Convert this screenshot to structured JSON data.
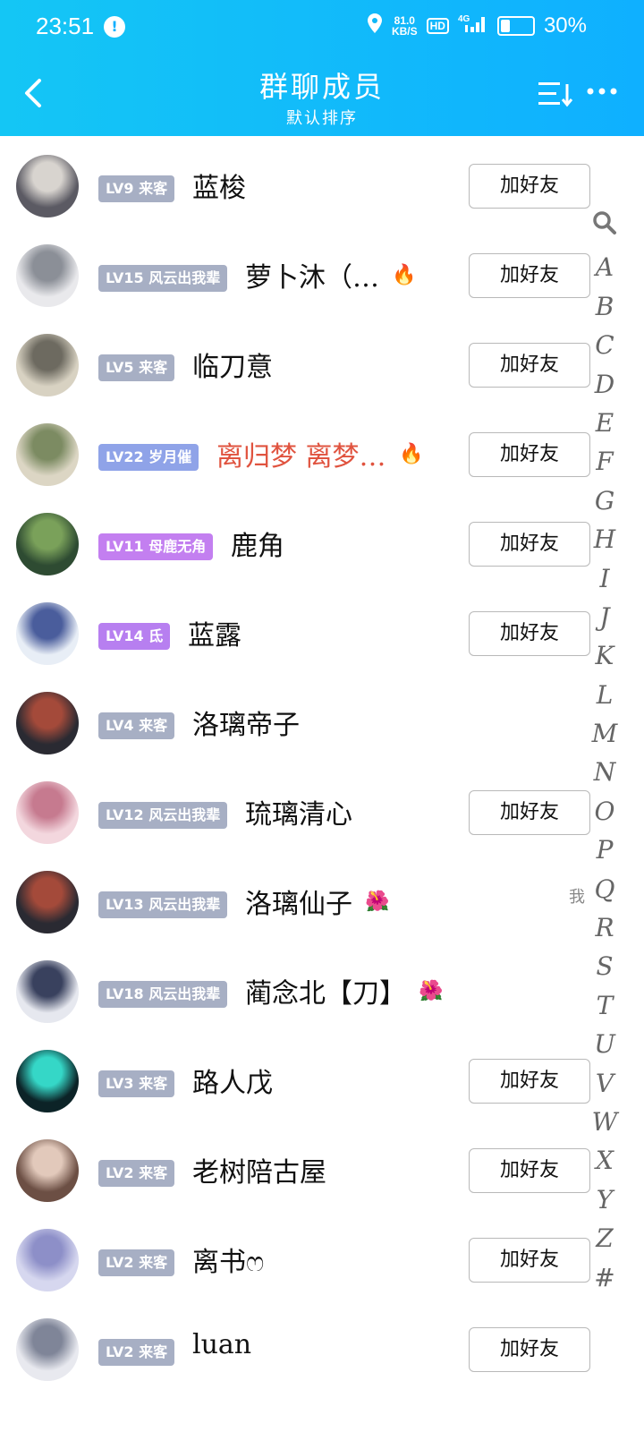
{
  "status_bar": {
    "time": "23:51",
    "notification": "!",
    "net_speed_value": "81.0",
    "net_speed_unit": "KB/S",
    "hd": "HD",
    "network": "4G",
    "battery_percent": "30%",
    "battery_level": 0.3
  },
  "nav": {
    "back_icon": "chevron-left-icon",
    "title": "群聊成员",
    "subtitle": "默认排序",
    "sort_icon": "sort-icon",
    "more_icon": "more-icon"
  },
  "members": [
    {
      "badge": "LV9 来客",
      "name": "蓝梭",
      "button": "加好友",
      "badge_color": "#a7afc4",
      "name_color": "#111111"
    },
    {
      "badge": "LV15 风云出我辈",
      "name": "萝卜沐（…",
      "button": "加好友",
      "emoji": "🔥",
      "badge_color": "#a7afc4",
      "name_color": "#111111"
    },
    {
      "badge": "LV5 来客",
      "name": "临刀意",
      "button": "加好友",
      "badge_color": "#a7afc4",
      "name_color": "#111111"
    },
    {
      "badge": "LV22 岁月催",
      "name": "离归梦 离梦…",
      "button": "加好友",
      "emoji": "🔥",
      "badge_color": "#8fa3e8",
      "name_color": "#e0533f"
    },
    {
      "badge": "LV11 母鹿无角",
      "name": "鹿角",
      "button": "加好友",
      "badge_color": "#c37ff0",
      "name_color": "#111111"
    },
    {
      "badge": "LV14 氐",
      "name": "蓝露",
      "button": "加好友",
      "badge_color": "#b77ff0",
      "name_color": "#111111"
    },
    {
      "badge": "LV4 来客",
      "name": "洛璃帝子",
      "button": "",
      "badge_color": "#a7afc4",
      "name_color": "#111111"
    },
    {
      "badge": "LV12 风云出我辈",
      "name": "琉璃清心",
      "button": "加好友",
      "badge_color": "#a7afc4",
      "name_color": "#111111"
    },
    {
      "badge": "LV13 风云出我辈",
      "name": "洛璃仙子",
      "button": "",
      "emoji": "🌺",
      "badge_color": "#a7afc4",
      "name_color": "#111111"
    },
    {
      "badge": "LV18 风云出我辈",
      "name": "蔺念北【刀】",
      "button": "",
      "emoji": "🌺",
      "badge_color": "#a7afc4",
      "name_color": "#111111"
    },
    {
      "badge": "LV3 来客",
      "name": "路人戊",
      "button": "加好友",
      "badge_color": "#a7afc4",
      "name_color": "#111111"
    },
    {
      "badge": "LV2 来客",
      "name": "老树陪古屋",
      "button": "加好友",
      "badge_color": "#a7afc4",
      "name_color": "#111111"
    },
    {
      "badge": "LV2 来客",
      "name": "离书ෆ",
      "button": "加好友",
      "badge_color": "#a7afc4",
      "name_color": "#111111"
    },
    {
      "badge": "LV2 来客",
      "name": "luan",
      "button": "加好友",
      "badge_color": "#a7afc4",
      "name_color": "#111111"
    }
  ],
  "index_bar": {
    "search_icon": "search-icon",
    "letters": [
      "A",
      "B",
      "C",
      "D",
      "E",
      "F",
      "G",
      "H",
      "I",
      "J",
      "K",
      "L",
      "M",
      "N",
      "O",
      "P",
      "Q",
      "R",
      "S",
      "T",
      "U",
      "V",
      "W",
      "X",
      "Y",
      "Z",
      "#"
    ],
    "me_label": "我"
  },
  "colors": {
    "header_start": "#14c6f5",
    "header_end": "#0fb0ff"
  }
}
